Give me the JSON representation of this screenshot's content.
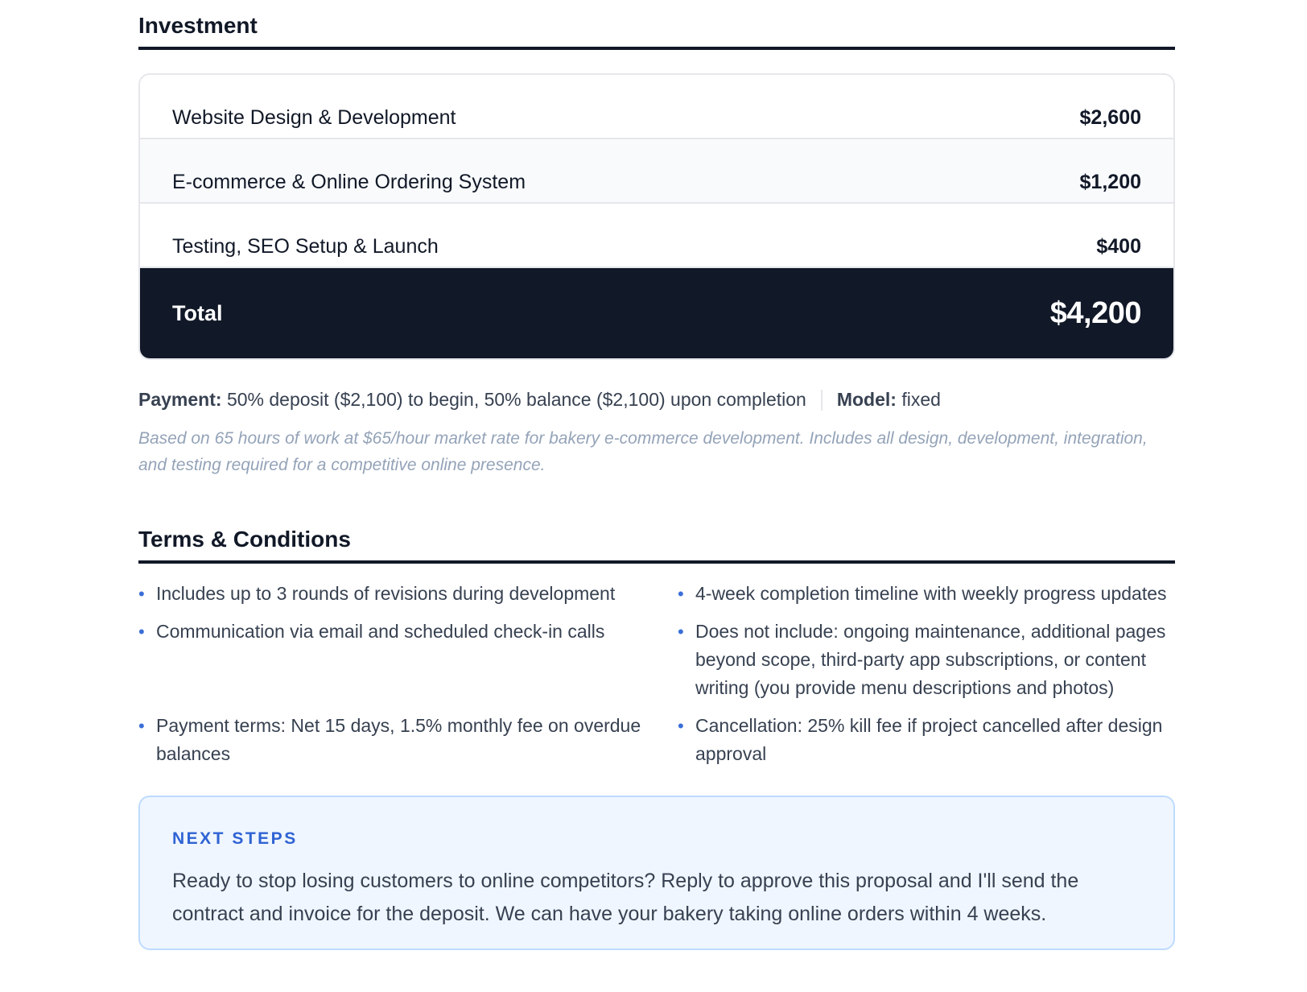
{
  "investment": {
    "title": "Investment",
    "items": [
      {
        "label": "Website Design & Development",
        "amount": "$2,600"
      },
      {
        "label": "E-commerce & Online Ordering System",
        "amount": "$1,200"
      },
      {
        "label": "Testing, SEO Setup & Launch",
        "amount": "$400"
      }
    ],
    "total_label": "Total",
    "total_amount": "$4,200",
    "payment_label": "Payment:",
    "payment_text": "50% deposit ($2,100) to begin, 50% balance ($2,100) upon completion",
    "model_label": "Model:",
    "model_text": "fixed",
    "note": "Based on 65 hours of work at $65/hour market rate for bakery e-commerce development. Includes all design, development, integration, and testing required for a competitive online presence."
  },
  "terms": {
    "title": "Terms & Conditions",
    "bullet": "•",
    "items": [
      "Includes up to 3 rounds of revisions during development",
      "4-week completion timeline with weekly progress updates",
      "Communication via email and scheduled check-in calls",
      "Does not include: ongoing maintenance, additional pages beyond scope, third-party app subscriptions, or content writing (you provide menu descriptions and photos)",
      "Payment terms: Net 15 days, 1.5% monthly fee on overdue balances",
      "Cancellation: 25% kill fee if project cancelled after design approval"
    ]
  },
  "next_steps": {
    "label": "NEXT STEPS",
    "text": "Ready to stop losing customers to online competitors? Reply to approve this proposal and I'll send the contract and invoice for the deposit. We can have your bakery taking online orders within 4 weeks."
  },
  "colors": {
    "dark": "#111827",
    "accent": "#2f63d3",
    "next_bg": "#eff6ff",
    "next_border": "#bfdbfe"
  }
}
